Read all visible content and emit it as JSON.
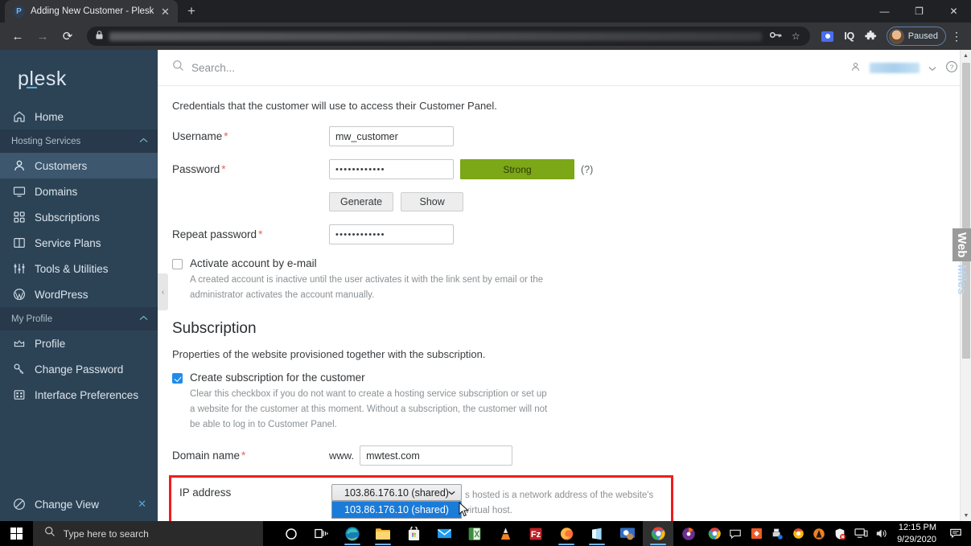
{
  "browser": {
    "tab": {
      "title": "Adding New Customer - Plesk Ob",
      "favicon_letter": "P",
      "close": "✕"
    },
    "new_tab": "+",
    "window_controls": {
      "minimize": "—",
      "maximize": "❐",
      "close": "✕"
    },
    "nav": {
      "back": "←",
      "forward": "→",
      "reload": "⟳"
    },
    "omnibox": {
      "lock": "🔒",
      "url_redacted": ""
    },
    "omnibox_icons": {
      "key": "⚷",
      "bookmark": "☆"
    },
    "extensions": {
      "screenshot": "camera-icon",
      "iq_label": "IQ",
      "puzzle": "🧩"
    },
    "profile": {
      "status": "Paused"
    },
    "menu": "⋮"
  },
  "plesk": {
    "logo": "plesk",
    "search": {
      "placeholder": "Search...",
      "value": ""
    },
    "sidebar": {
      "items": [
        {
          "label": "Home",
          "icon": "home-icon",
          "type": "item",
          "active": false
        },
        {
          "label": "Hosting Services",
          "icon": "chevron-up-icon",
          "type": "group"
        },
        {
          "label": "Customers",
          "icon": "user-icon",
          "type": "item",
          "active": true
        },
        {
          "label": "Domains",
          "icon": "monitor-icon",
          "type": "item",
          "active": false
        },
        {
          "label": "Subscriptions",
          "icon": "grid-icon",
          "type": "item",
          "active": false
        },
        {
          "label": "Service Plans",
          "icon": "book-icon",
          "type": "item",
          "active": false
        },
        {
          "label": "Tools & Utilities",
          "icon": "sliders-icon",
          "type": "item",
          "active": false
        },
        {
          "label": "WordPress",
          "icon": "wordpress-icon",
          "type": "item",
          "active": false
        },
        {
          "label": "My Profile",
          "icon": "chevron-up-icon",
          "type": "group"
        },
        {
          "label": "Profile",
          "icon": "crown-icon",
          "type": "item",
          "active": false
        },
        {
          "label": "Change Password",
          "icon": "key-icon",
          "type": "item",
          "active": false
        },
        {
          "label": "Interface Preferences",
          "icon": "preferences-icon",
          "type": "item",
          "active": false
        }
      ],
      "footer": {
        "label": "Change View",
        "icon": "circle-slash-icon",
        "close": "✕"
      },
      "collapse": "‹"
    },
    "form": {
      "lead": "Credentials that the customer will use to access their Customer Panel.",
      "username": {
        "label": "Username",
        "required": "*",
        "value": "mw_customer"
      },
      "password": {
        "label": "Password",
        "required": "*",
        "value": "••••••••••••",
        "strength": "Strong",
        "strength_color": "#7ca716",
        "hint": "(?)"
      },
      "buttons": {
        "generate": "Generate",
        "show": "Show"
      },
      "repeat_password": {
        "label": "Repeat password",
        "required": "*",
        "value": "••••••••••••"
      },
      "activate": {
        "label": "Activate account by e-mail",
        "checked": false,
        "help": "A created account is inactive until the user activates it with the link sent by email or the administrator activates the account manually."
      }
    },
    "subscription": {
      "title": "Subscription",
      "lead": "Properties of the website provisioned together with the subscription.",
      "create": {
        "label": "Create subscription for the customer",
        "checked": true,
        "help": "Clear this checkbox if you do not want to create a hosting service subscription or set up a website for the customer at this moment. Without a subscription, the customer will not be able to log in to Customer Panel."
      },
      "domain": {
        "label": "Domain name",
        "required": "*",
        "prefix": "www.",
        "value": "mwtest.com"
      },
      "ip": {
        "label": "IP address",
        "selected": "103.86.176.10 (shared)",
        "caret": "⌄",
        "options": [
          "103.86.176.10 (shared)"
        ],
        "help": "s hosted is a network address of the website's virtual host.",
        "highlight_color": "#ef1d1d"
      }
    },
    "watermark": {
      "top": "Web",
      "bottom": "Miles"
    },
    "scrollbar": {
      "up": "▲",
      "down": "▼"
    }
  },
  "taskbar": {
    "start": "windows-logo",
    "search_placeholder": "Type here to search",
    "items": [
      {
        "name": "cortana-icon"
      },
      {
        "name": "task-view-icon"
      },
      {
        "name": "edge-icon"
      },
      {
        "name": "file-explorer-icon"
      },
      {
        "name": "microsoft-store-icon"
      },
      {
        "name": "mail-icon"
      },
      {
        "name": "excel-icon"
      },
      {
        "name": "vlc-icon"
      },
      {
        "name": "filezilla-icon"
      },
      {
        "name": "firefox-icon"
      },
      {
        "name": "onenote-icon"
      },
      {
        "name": "teamviewer-icon"
      },
      {
        "name": "chrome-icon"
      },
      {
        "name": "media-player-icon"
      }
    ],
    "tray": [
      {
        "name": "chrome-tray-icon"
      },
      {
        "name": "speech-bubble-icon"
      },
      {
        "name": "orange-square-icon"
      },
      {
        "name": "printer-icon"
      },
      {
        "name": "chrome-small-icon"
      },
      {
        "name": "avast-icon"
      },
      {
        "name": "security-icon"
      },
      {
        "name": "network-icon"
      },
      {
        "name": "volume-icon"
      }
    ],
    "clock": {
      "time": "12:15 PM",
      "date": "9/29/2020"
    },
    "notifications": "notification-icon"
  }
}
